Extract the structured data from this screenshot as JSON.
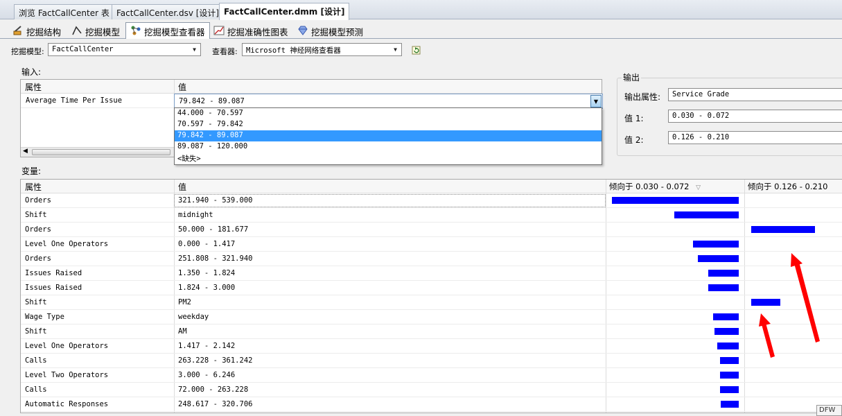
{
  "doc_tabs": [
    "浏览 FactCallCenter 表",
    "FactCallCenter.dsv [设计]",
    "FactCallCenter.dmm [设计]"
  ],
  "designer_tabs": [
    {
      "label": "挖掘结构",
      "icon": "mining-structure-icon"
    },
    {
      "label": "挖掘模型",
      "icon": "mining-models-icon"
    },
    {
      "label": "挖掘模型查看器",
      "icon": "model-viewer-icon"
    },
    {
      "label": "挖掘准确性图表",
      "icon": "accuracy-chart-icon"
    },
    {
      "label": "挖掘模型预测",
      "icon": "prediction-icon"
    }
  ],
  "toolbar": {
    "model_label": "挖掘模型:",
    "model_value": "FactCallCenter",
    "viewer_label": "查看器:",
    "viewer_value": "Microsoft 神经网络查看器"
  },
  "input": {
    "label": "输入:",
    "col_attr": "属性",
    "col_value": "值",
    "attribute": "Average Time Per Issue",
    "value": "79.842 - 89.087",
    "options": [
      "44.000 - 70.597",
      "70.597 - 79.842",
      "79.842 - 89.087",
      "89.087 - 120.000",
      "<缺失>"
    ],
    "selected_index": 2
  },
  "output": {
    "label": "输出",
    "attr_label": "输出属性:",
    "attr_value": "Service Grade",
    "v1_label": "值 1:",
    "v1_value": "0.030 - 0.072",
    "v2_label": "值 2:",
    "v2_value": "0.126 - 0.210"
  },
  "variables": {
    "label": "变量:",
    "col_attr": "属性",
    "col_value": "值",
    "col_fav1": "倾向于 0.030 - 0.072",
    "col_fav2": "倾向于 0.126 - 0.210",
    "rows": [
      {
        "attr": "Orders",
        "value": "321.940 - 539.000",
        "fav1": 1.0,
        "fav2": 0
      },
      {
        "attr": "Shift",
        "value": "midnight",
        "fav1": 0.51,
        "fav2": 0
      },
      {
        "attr": "Orders",
        "value": "50.000 - 181.677",
        "fav1": 0,
        "fav2": 0.5
      },
      {
        "attr": "Level One Operators",
        "value": "0.000 - 1.417",
        "fav1": 0.36,
        "fav2": 0
      },
      {
        "attr": "Orders",
        "value": "251.808 - 321.940",
        "fav1": 0.32,
        "fav2": 0
      },
      {
        "attr": "Issues Raised",
        "value": "1.350 - 1.824",
        "fav1": 0.24,
        "fav2": 0
      },
      {
        "attr": "Issues Raised",
        "value": "1.824 - 3.000",
        "fav1": 0.24,
        "fav2": 0
      },
      {
        "attr": "Shift",
        "value": "PM2",
        "fav1": 0,
        "fav2": 0.23
      },
      {
        "attr": "Wage Type",
        "value": "weekday",
        "fav1": 0.2,
        "fav2": 0
      },
      {
        "attr": "Shift",
        "value": "AM",
        "fav1": 0.19,
        "fav2": 0
      },
      {
        "attr": "Level One Operators",
        "value": "1.417 - 2.142",
        "fav1": 0.17,
        "fav2": 0
      },
      {
        "attr": "Calls",
        "value": "263.228 - 361.242",
        "fav1": 0.15,
        "fav2": 0
      },
      {
        "attr": "Level Two Operators",
        "value": "3.000 - 6.246",
        "fav1": 0.15,
        "fav2": 0
      },
      {
        "attr": "Calls",
        "value": "72.000 - 263.228",
        "fav1": 0.15,
        "fav2": 0
      },
      {
        "attr": "Automatic Responses",
        "value": "248.617 - 320.706",
        "fav1": 0.14,
        "fav2": 0
      }
    ]
  },
  "colors": {
    "bar": "#0000ff",
    "arrow": "#ff0000",
    "selection": "#3399ff"
  },
  "watermark": "DFW"
}
